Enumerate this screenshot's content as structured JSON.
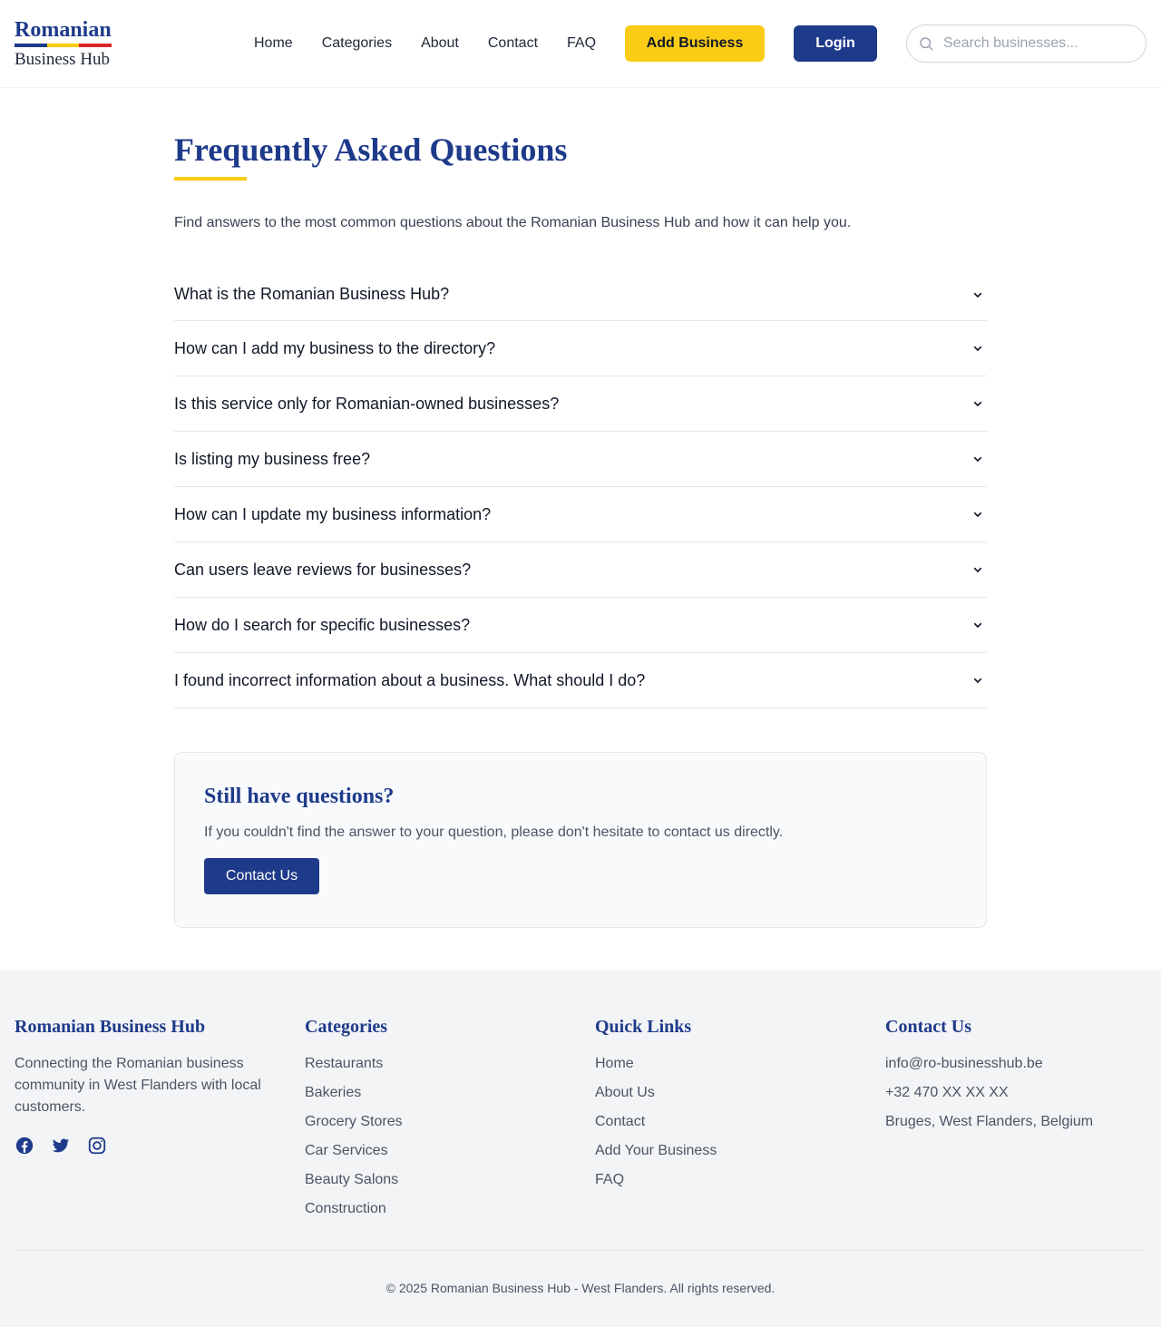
{
  "header": {
    "logo_title": "Romanian",
    "logo_subtitle": "Business Hub",
    "flag_colors": [
      "#1e3a8a",
      "#facc15",
      "#dc2626"
    ],
    "nav": [
      "Home",
      "Categories",
      "About",
      "Contact",
      "FAQ"
    ],
    "add_business_label": "Add Business",
    "login_label": "Login",
    "search_placeholder": "Search businesses...",
    "search_icon": "search-icon"
  },
  "main": {
    "title": "Frequently Asked Questions",
    "intro": "Find answers to the most common questions about the Romanian Business Hub and how it can help you.",
    "faqs": [
      "What is the Romanian Business Hub?",
      "How can I add my business to the directory?",
      "Is this service only for Romanian-owned businesses?",
      "Is listing my business free?",
      "How can I update my business information?",
      "Can users leave reviews for businesses?",
      "How do I search for specific businesses?",
      "I found incorrect information about a business. What should I do?"
    ],
    "faq_icon": "chevron-down-icon",
    "cta": {
      "title": "Still have questions?",
      "text": "If you couldn't find the answer to your question, please don't hesitate to contact us directly.",
      "button_label": "Contact Us"
    }
  },
  "footer": {
    "about": {
      "title": "Romanian Business Hub",
      "text": "Connecting the Romanian business community in West Flanders with local customers.",
      "social_icons": [
        "facebook-icon",
        "twitter-icon",
        "instagram-icon"
      ]
    },
    "categories": {
      "title": "Categories",
      "items": [
        "Restaurants",
        "Bakeries",
        "Grocery Stores",
        "Car Services",
        "Beauty Salons",
        "Construction"
      ]
    },
    "quick_links": {
      "title": "Quick Links",
      "items": [
        "Home",
        "About Us",
        "Contact",
        "Add Your Business",
        "FAQ"
      ]
    },
    "contact": {
      "title": "Contact Us",
      "items": [
        "info@ro-businesshub.be",
        "+32 470 XX XX XX",
        "Bruges, West Flanders, Belgium"
      ]
    },
    "copyright": "© 2025 Romanian Business Hub - West Flanders. All rights reserved."
  },
  "colors": {
    "primary": "#1e3a8a",
    "accent": "#facc15",
    "footer_bg": "#f3f4f6"
  }
}
